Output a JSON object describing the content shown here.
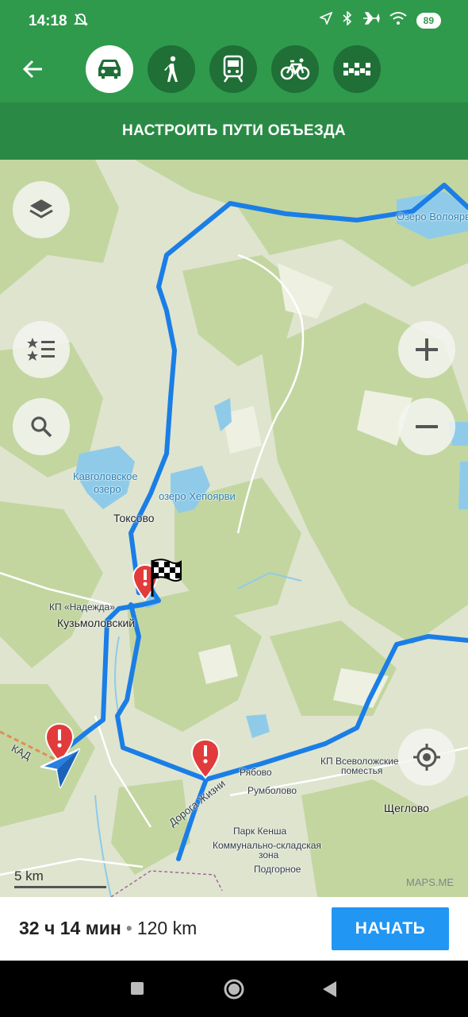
{
  "status_bar": {
    "time": "14:18",
    "battery": "89",
    "icons": [
      "dnd-off-icon",
      "location-arrow-icon",
      "bluetooth-icon",
      "airplane-icon",
      "wifi-icon",
      "battery-icon"
    ]
  },
  "toolbar": {
    "back_icon": "arrow-left-icon",
    "modes": [
      {
        "name": "car",
        "icon": "car-icon",
        "active": true
      },
      {
        "name": "pedestrian",
        "icon": "walk-icon",
        "active": false
      },
      {
        "name": "transit",
        "icon": "train-icon",
        "active": false
      },
      {
        "name": "bicycle",
        "icon": "bicycle-icon",
        "active": false
      },
      {
        "name": "taxi",
        "icon": "taxi-icon",
        "active": false
      }
    ]
  },
  "reroute": {
    "label": "НАСТРОИТЬ ПУТИ ОБЪЕЗДА"
  },
  "map": {
    "labels": {
      "lake_voloyarv": "Озеро Волоярв",
      "kavgolovskoe_1": "Кавголовское",
      "kavgolovskoe_2": "озеро",
      "lake_khepoyarvi": "озеро Хепоярви",
      "toksovo": "Токсово",
      "kp_nadezhda": "КП «Надежда»",
      "kuzmolovsky": "Кузьмоловский",
      "kad": "КАД",
      "kp_vsevolozhskie_1": "КП Всеволожские",
      "kp_vsevolozhskie_2": "поместья",
      "ryabovo": "Рябово",
      "rumbolovo": "Румболово",
      "shcheglovo": "Щеглово",
      "doroga_zhizni": "Дорога Жизни",
      "park_kensha": "Парк Кенша",
      "kommunalno_1": "Коммунально-складская",
      "kommunalno_2": "зона",
      "podgornoe": "Подгорное"
    },
    "scale": "5 km",
    "attribution": "MAPS.ME",
    "controls": [
      "layers-icon",
      "bookmarks-icon",
      "search-icon",
      "zoom-in-icon",
      "zoom-out-icon",
      "my-location-icon"
    ],
    "colors": {
      "route": "#1a7ee6",
      "forest": "#c3d6a0",
      "water": "#8fcbe9",
      "toolbar": "#2f9a4c",
      "start": "#2196f3"
    }
  },
  "route": {
    "time": "32 ч 14 мин",
    "separator": "•",
    "distance": "120 km",
    "start_label": "НАЧАТЬ"
  }
}
